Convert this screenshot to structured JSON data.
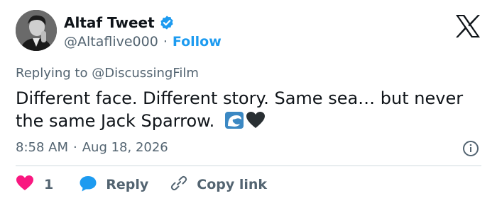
{
  "user": {
    "display_name": "Altaf Tweet",
    "handle": "@Altaflive000",
    "separator": "·",
    "follow_label": "Follow"
  },
  "tweet": {
    "reply_prefix": "Replying to ",
    "reply_mention": "@DiscussingFilm",
    "text": "Different face. Different story. Same sea… but never the same Jack Sparrow.",
    "emojis": [
      "wave-emoji",
      "black-heart-emoji"
    ],
    "time": "8:58 AM",
    "dot": "·",
    "date": "Aug 18, 2026"
  },
  "actions": {
    "like_count": "1",
    "reply_label": "Reply",
    "copy_link_label": "Copy link"
  },
  "colors": {
    "accent": "#1d9bf0",
    "like": "#f91880",
    "text": "#0f1419",
    "muted": "#536471",
    "divider": "#cfd9de"
  }
}
